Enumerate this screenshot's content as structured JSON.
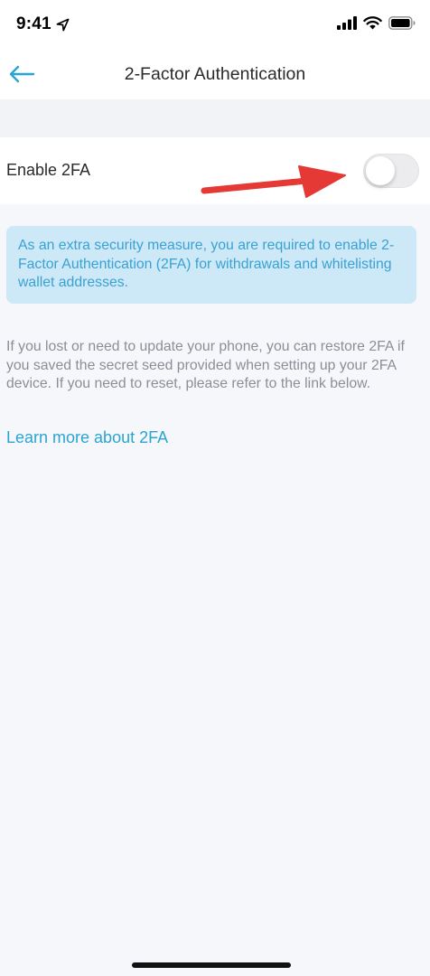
{
  "status_bar": {
    "time": "9:41",
    "icons": [
      "location-arrow-icon",
      "cellular-signal-icon",
      "wifi-icon",
      "battery-icon"
    ]
  },
  "header": {
    "title": "2-Factor Authentication",
    "back_icon": "arrow-left-icon"
  },
  "toggle": {
    "label": "Enable 2FA",
    "enabled": false
  },
  "info": {
    "text": "As an extra security measure, you are required to enable 2-Factor Authentication (2FA) for withdrawals and whitelisting wallet addresses."
  },
  "description": "If you lost or need to update your phone, you can restore 2FA if you saved the secret seed provided when setting up your 2FA device. If you need to reset, please refer to the link below.",
  "link": {
    "label": "Learn more about 2FA"
  },
  "colors": {
    "accent": "#2aa4d4",
    "info_bg": "#cde8f7",
    "info_text": "#3aa2d2",
    "annotation_arrow": "#e53935",
    "background": "#f6f7fb"
  }
}
